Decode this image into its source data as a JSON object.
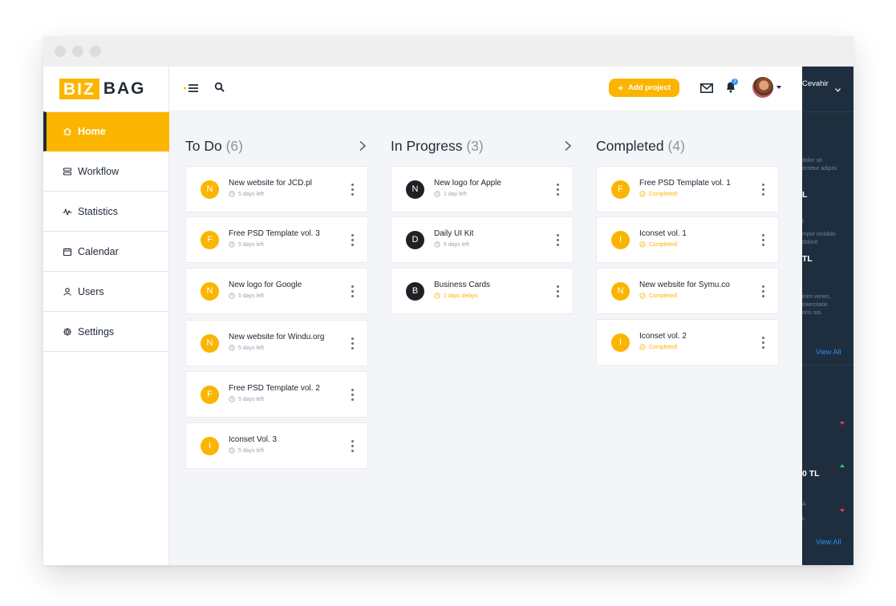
{
  "brand": {
    "part1": "BIZ",
    "part2": "BAG",
    "accent": "#fbb500",
    "dark": "#1e2b37"
  },
  "sidebar": {
    "items": [
      {
        "label": "Home",
        "icon": "home-icon",
        "active": true
      },
      {
        "label": "Workflow",
        "icon": "workflow-icon",
        "active": false
      },
      {
        "label": "Statistics",
        "icon": "statistics-icon",
        "active": false
      },
      {
        "label": "Calendar",
        "icon": "calendar-icon",
        "active": false
      },
      {
        "label": "Users",
        "icon": "users-icon",
        "active": false
      },
      {
        "label": "Settings",
        "icon": "settings-icon",
        "active": false
      }
    ]
  },
  "topbar": {
    "add_project_label": "Add project",
    "notification_count": "3",
    "icons": [
      "menu-toggle-icon",
      "search-icon",
      "mail-icon",
      "bell-icon",
      "chevron-down-icon"
    ]
  },
  "columns": [
    {
      "title": "To Do",
      "count": "(6)",
      "cards": [
        {
          "initial": "N",
          "title": "New website for JCD.pl",
          "meta": "5 days left",
          "status": "pending"
        },
        {
          "initial": "F",
          "title": "Free PSD Template vol. 3",
          "meta": "5 days left",
          "status": "pending"
        },
        {
          "initial": "N",
          "title": "New logo for Google",
          "meta": "5 days left",
          "status": "pending"
        },
        {
          "initial": "N",
          "title": "New website for Windu.org",
          "meta": "5 days left",
          "status": "pending"
        },
        {
          "initial": "F",
          "title": "Free PSD Template vol. 2",
          "meta": "5 days left",
          "status": "pending"
        },
        {
          "initial": "I",
          "title": "Iconset Vol. 3",
          "meta": "5 days left",
          "status": "pending"
        }
      ]
    },
    {
      "title": "In Progress",
      "count": "(3)",
      "cards": [
        {
          "initial": "N",
          "title": "New logo for Apple",
          "meta": "1 day left",
          "status": "progress"
        },
        {
          "initial": "D",
          "title": "Daily UI Kit",
          "meta": "5 days left",
          "status": "progress"
        },
        {
          "initial": "B",
          "title": "Business Cards",
          "meta": "2 days delays",
          "status": "late"
        }
      ]
    },
    {
      "title": "Completed",
      "count": "(4)",
      "cards": [
        {
          "initial": "F",
          "title": "Free PSD Template vol. 1",
          "meta": "Completed!",
          "status": "done"
        },
        {
          "initial": "I",
          "title": "Iconset vol. 1",
          "meta": "Completed!",
          "status": "done"
        },
        {
          "initial": "N",
          "title": "New website for Symu.co",
          "meta": "Completed!",
          "status": "done"
        },
        {
          "initial": "I",
          "title": "Iconset vol. 2",
          "meta": "Completed!",
          "status": "done"
        }
      ]
    }
  ],
  "right_panel": {
    "user_name": "Cevahir",
    "snippet1": [
      "dolor sit",
      "ectetur adipisi"
    ],
    "big1": "L",
    "snippet2": [
      "t",
      "mpor incididu",
      "dolore"
    ],
    "big2": "TL",
    "snippet3": [
      "inim venim,",
      "exercitatio",
      "oris nisi"
    ],
    "view_all_1": "View All",
    "big3": "0 TL",
    "snippet4": "A",
    "snippet5": "L",
    "view_all_2": "View All"
  },
  "colors": {
    "avatar_orange": "#fbb500",
    "avatar_dark": "#1e2226",
    "board_bg": "#f4f5f8",
    "panel_bg": "#1e2e3e",
    "link_blue": "#2e8ff0",
    "down_red": "#e0424b",
    "up_green": "#2ecc71"
  }
}
